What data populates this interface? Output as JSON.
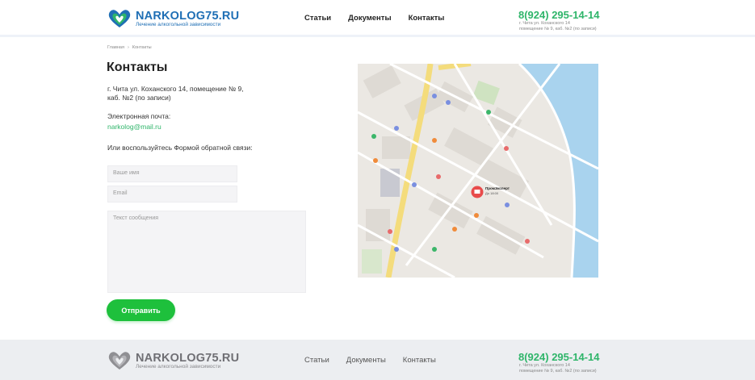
{
  "header": {
    "logo_title": "NARKOLOG75.RU",
    "logo_subtitle": "Лечение алкогольной зависимости",
    "nav": [
      "Статьи",
      "Документы",
      "Контакты"
    ],
    "phone": "8(924) 295-14-14",
    "address_line1": "г. Чита ул. Коханского 14",
    "address_line2": "помещение № 9, каб. №2 (по записи)"
  },
  "breadcrumb": [
    "Главная",
    "›",
    "Контакты"
  ],
  "page": {
    "title": "Контакты",
    "address": "г. Чита ул. Коханского 14, помещение № 9, каб. №2 (по записи)",
    "email_label": "Электронная почта:",
    "email": "narkolog@mail.ru",
    "form_hint": "Или воспользуйтесь Формой обратной связи:"
  },
  "form": {
    "name_placeholder": "Ваше имя",
    "email_placeholder": "Email",
    "message_placeholder": "Текст сообщения",
    "submit_label": "Отправить"
  },
  "map": {
    "marker_title": "ПромЭксперт",
    "marker_sub": "До 18:00"
  },
  "colors": {
    "brand_blue": "#1f6fb5",
    "accent_green": "#2fb56a",
    "button_green": "#1ec03c"
  },
  "footer": {
    "logo_title": "NARKOLOG75.RU",
    "logo_subtitle": "Лечение алкогольной зависимости",
    "nav": [
      "Статьи",
      "Документы",
      "Контакты"
    ],
    "phone": "8(924) 295-14-14",
    "address_line1": "г. Чита ул. Коханского 14",
    "address_line2": "помещение № 9, каб. №2 (по записи)"
  }
}
